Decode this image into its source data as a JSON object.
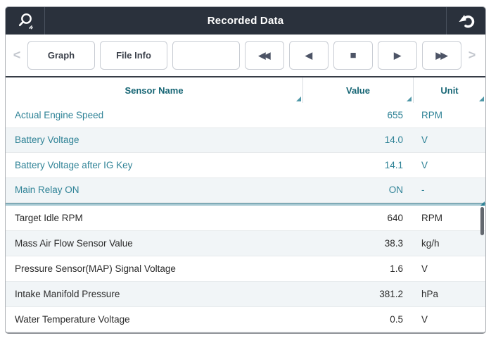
{
  "header": {
    "title": "Recorded Data"
  },
  "toolbar": {
    "prev_chevron": "<",
    "next_chevron": ">",
    "buttons": [
      {
        "label": "Graph"
      },
      {
        "label": "File Info"
      },
      {
        "label": ""
      }
    ],
    "playback": [
      {
        "name": "rewind",
        "glyph": "◀◀"
      },
      {
        "name": "step-back",
        "glyph": "◀"
      },
      {
        "name": "stop",
        "glyph": "■"
      },
      {
        "name": "play",
        "glyph": "▶"
      },
      {
        "name": "fast-forward",
        "glyph": "▶▶"
      }
    ]
  },
  "table": {
    "columns": [
      "Sensor Name",
      "Value",
      "Unit"
    ],
    "pinned_rows": [
      {
        "name": "Actual Engine Speed",
        "value": "655",
        "unit": "RPM"
      },
      {
        "name": "Battery Voltage",
        "value": "14.0",
        "unit": "V"
      },
      {
        "name": "Battery Voltage after IG Key",
        "value": "14.1",
        "unit": "V"
      },
      {
        "name": "Main Relay ON",
        "value": "ON",
        "unit": "-"
      }
    ],
    "rows": [
      {
        "name": "Target Idle RPM",
        "value": "640",
        "unit": "RPM"
      },
      {
        "name": "Mass Air Flow Sensor Value",
        "value": "38.3",
        "unit": "kg/h"
      },
      {
        "name": "Pressure Sensor(MAP) Signal Voltage",
        "value": "1.6",
        "unit": "V"
      },
      {
        "name": "Intake Manifold Pressure",
        "value": "381.2",
        "unit": "hPa"
      },
      {
        "name": "Water Temperature Voltage",
        "value": "0.5",
        "unit": "V"
      }
    ]
  },
  "colors": {
    "titlebar_bg": "#2a313c",
    "header_text_teal": "#176675",
    "pinned_row_teal": "#2e8296",
    "divider_teal": "#a7c9d3",
    "toolbar_icon": "#4d5466"
  }
}
